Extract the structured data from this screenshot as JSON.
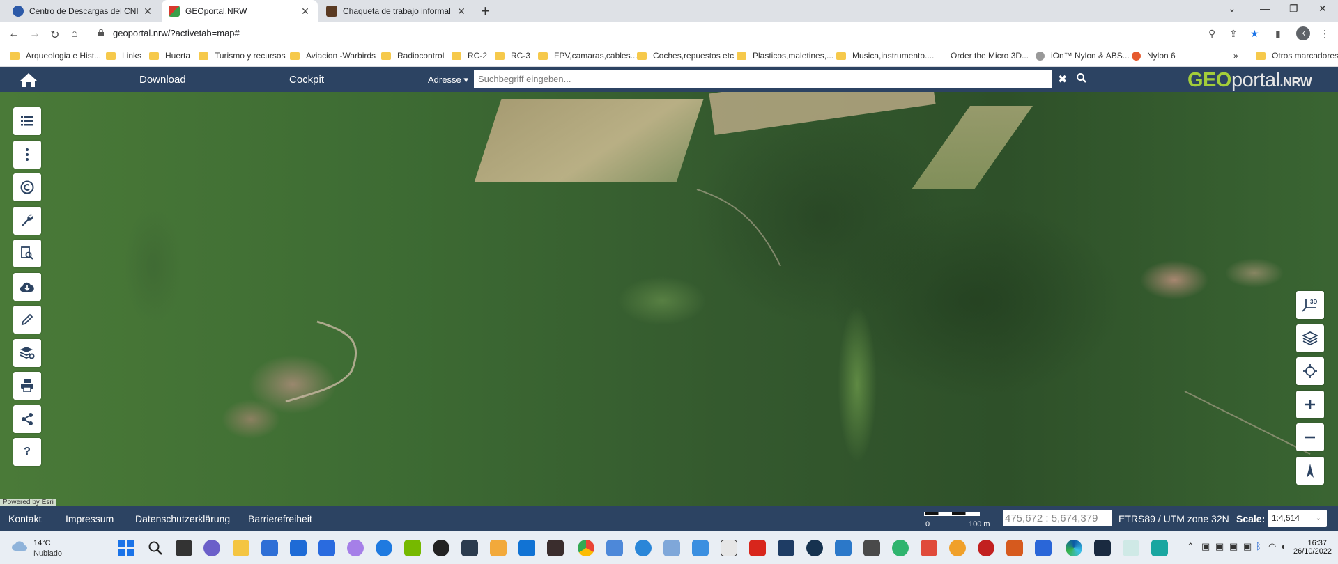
{
  "browser": {
    "tabs": [
      {
        "title": "Centro de Descargas del CNIG (I…",
        "active": false
      },
      {
        "title": "GEOportal.NRW",
        "active": true
      },
      {
        "title": "Chaqueta de trabajo informal cá…",
        "active": false
      }
    ],
    "url": "geoportal.nrw/?activetab=map#",
    "profile_initial": "k",
    "bookmarks": [
      "Arqueologia e Hist...",
      "Links",
      "Huerta",
      "Turismo y recursos",
      "Aviacion -Warbirds",
      "Radiocontrol",
      "RC-2",
      "RC-3",
      "FPV,camaras,cables....",
      "Coches,repuestos etc",
      "Plasticos,maletines,...",
      "Musica,instrumento....",
      "Order the Micro 3D...",
      "iOn™ Nylon & ABS...",
      "Nylon 6"
    ],
    "bookmarks_more": "»",
    "other_bookmarks": "Otros marcadores"
  },
  "app": {
    "menu": {
      "download": "Download",
      "cockpit": "Cockpit",
      "adresse": "Adresse"
    },
    "search_placeholder": "Suchbegriff eingeben...",
    "logo": {
      "geo": "GEO",
      "portal": "portal",
      "nrw": ".NRW"
    },
    "attribution": "Powered by Esri",
    "right_tools": {
      "threed": "3D"
    },
    "help": "?"
  },
  "footer": {
    "links": [
      "Kontakt",
      "Impressum",
      "Datenschutzerklärung",
      "Barrierefreiheit"
    ],
    "scale_start": "0",
    "scale_end": "100 m",
    "coordinates": "475,672 : 5,674,379",
    "crs": "ETRS89 / UTM zone 32N",
    "scale_label": "Scale:",
    "scale_value": "1:4,514"
  },
  "taskbar": {
    "temperature": "14°C",
    "condition": "Nublado",
    "time": "16:37",
    "date": "26/10/2022"
  },
  "colors": {
    "header": "#2c4362",
    "logo_green": "#a3cd3a",
    "taskbar": "#e9eef4"
  }
}
